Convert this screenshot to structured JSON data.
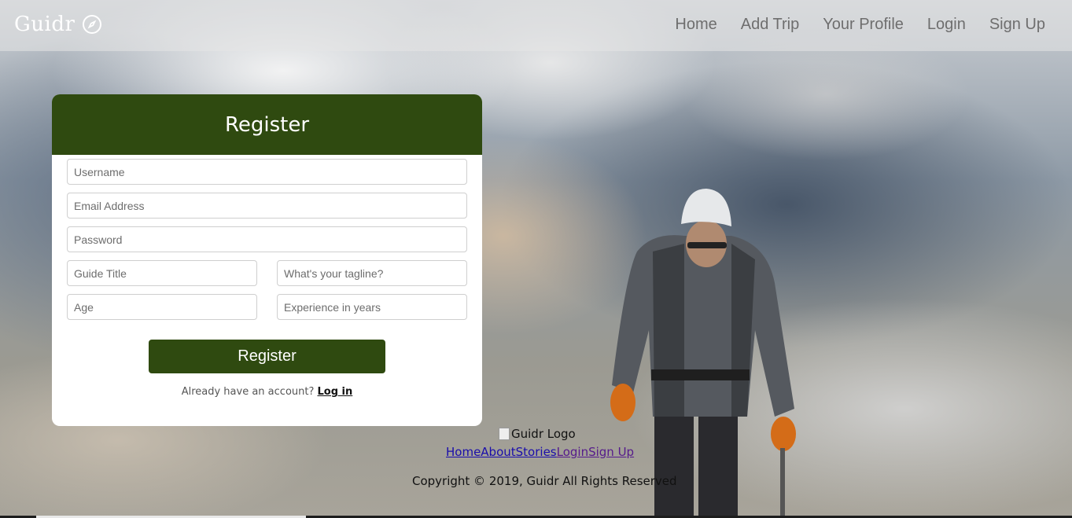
{
  "colors": {
    "brand_green": "#2f4a10",
    "nav_text": "#6e6e6e",
    "link_blue": "#1a0dab",
    "link_visited": "#551a8b"
  },
  "navbar": {
    "brand": "Guidr",
    "brand_icon": "compass-icon",
    "links": [
      "Home",
      "Add Trip",
      "Your Profile",
      "Login",
      "Sign Up"
    ]
  },
  "register": {
    "title": "Register",
    "fields": {
      "username": "Username",
      "email": "Email Address",
      "password": "Password",
      "guide_title": "Guide Title",
      "tagline": "What's your tagline?",
      "age": "Age",
      "experience": "Experience in years"
    },
    "submit_label": "Register",
    "already_text": "Already have an account?",
    "login_link": "Log in"
  },
  "footer": {
    "logo_alt": "Guidr Logo",
    "links": [
      "Home",
      "About",
      "Stories",
      "Login",
      "Sign Up"
    ],
    "copyright": "Copyright © 2019, Guidr All Rights Reserved"
  }
}
